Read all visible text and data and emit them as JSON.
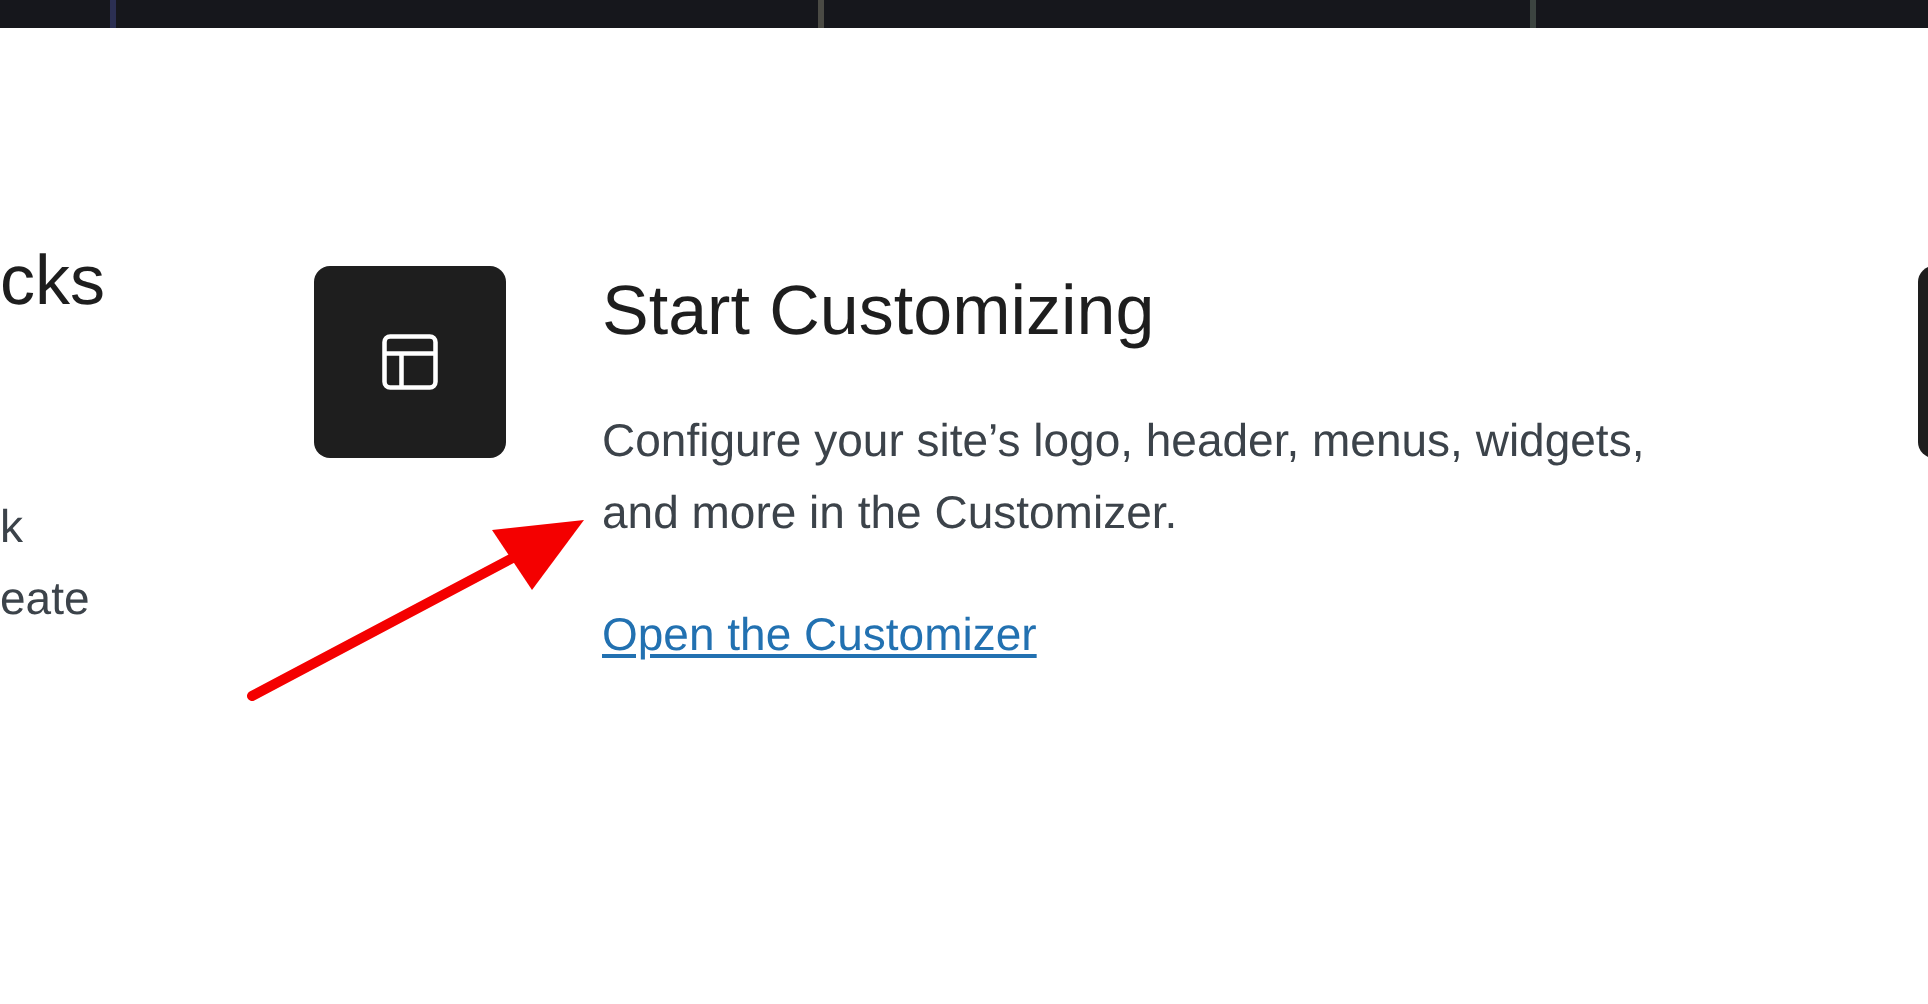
{
  "left_card": {
    "title": "cks",
    "description_lines": [
      "k",
      "eate"
    ]
  },
  "customize_card": {
    "title": "Start Customizing",
    "description": "Configure your site’s logo, header, menus, widgets, and more in the Customizer.",
    "link": "Open the Customizer"
  }
}
